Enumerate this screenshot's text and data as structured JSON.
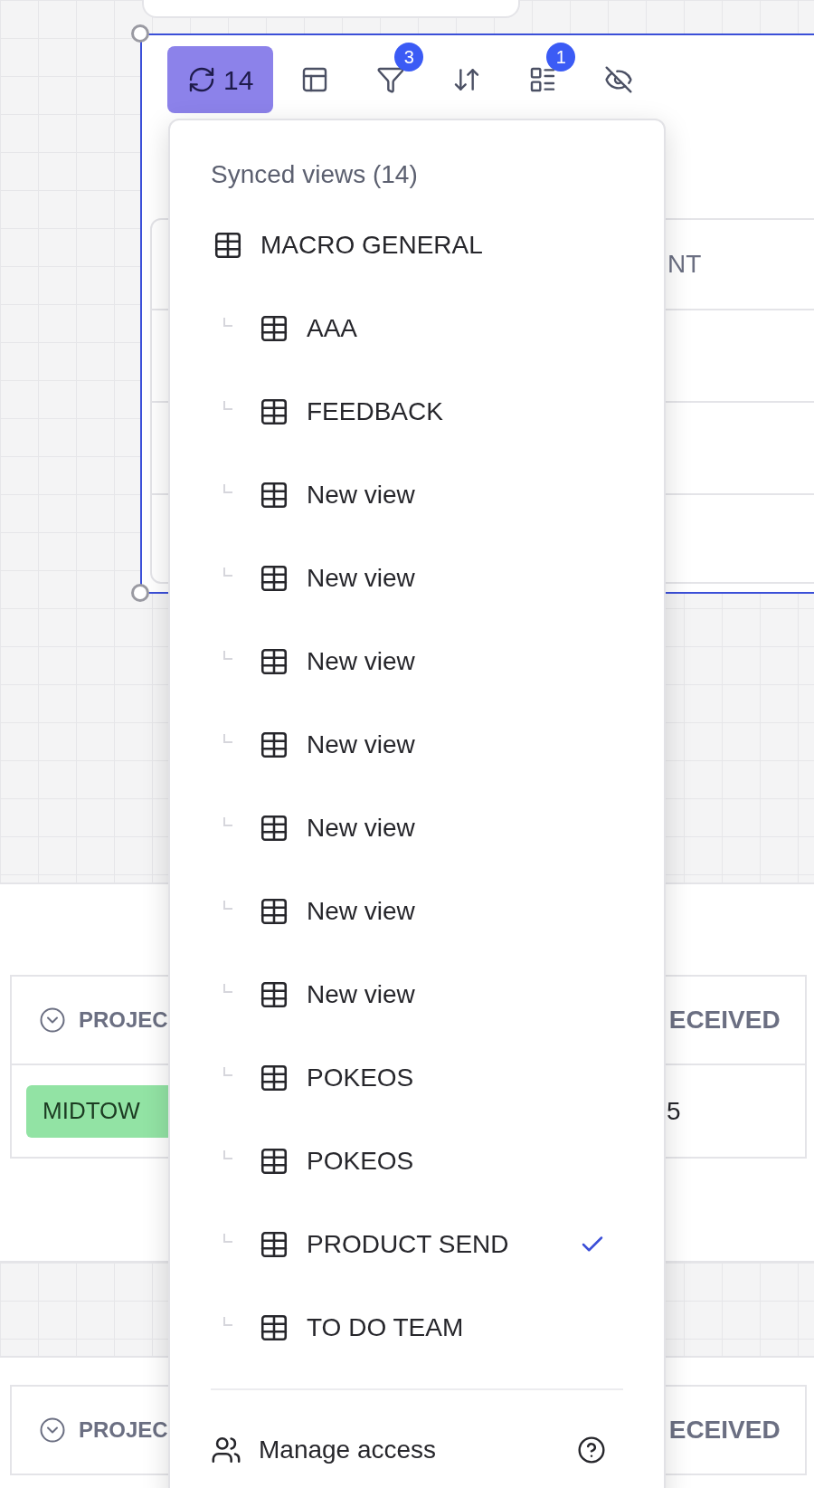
{
  "toolbar": [
    {
      "kind": "sync",
      "label": "14",
      "selected": true
    },
    {
      "kind": "layout",
      "selected": false
    },
    {
      "kind": "filter",
      "badge": "3",
      "selected": false
    },
    {
      "kind": "sort",
      "selected": false
    },
    {
      "kind": "fields",
      "badge": "1",
      "selected": false
    },
    {
      "kind": "hide",
      "selected": false
    }
  ],
  "widget_table": {
    "header": "NT"
  },
  "menu": {
    "title": "Synced views (14)",
    "views": [
      {
        "label": "MACRO GENERAL",
        "selected": false,
        "children": [
          {
            "label": "AAA",
            "selected": false
          },
          {
            "label": "FEEDBACK",
            "selected": false
          },
          {
            "label": "New view",
            "selected": false
          },
          {
            "label": "New view",
            "selected": false
          },
          {
            "label": "New view",
            "selected": false
          },
          {
            "label": "New view",
            "selected": false
          },
          {
            "label": "New view",
            "selected": false
          },
          {
            "label": "New view",
            "selected": false
          },
          {
            "label": "New view",
            "selected": false
          },
          {
            "label": "POKEOS",
            "selected": false
          },
          {
            "label": "POKEOS",
            "selected": false
          },
          {
            "label": "PRODUCT SEND",
            "selected": true
          },
          {
            "label": "TO DO TEAM",
            "selected": false
          }
        ]
      }
    ],
    "footer": {
      "label": "Manage access"
    }
  },
  "tables": [
    {
      "headers": [
        "PROJEC",
        "ECEIVED"
      ],
      "rows": [
        {
          "tag": "MIDTOW",
          "color": "#92e3a4",
          "value": "5"
        }
      ]
    },
    {
      "headers": [
        "PROJEC",
        "ECEIVED"
      ]
    }
  ]
}
